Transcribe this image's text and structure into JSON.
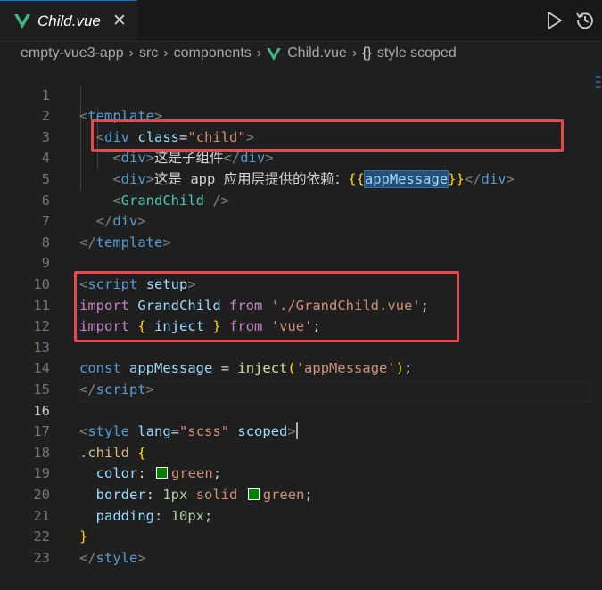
{
  "tab": {
    "label": "Child.vue",
    "close": "✕"
  },
  "breadcrumb": {
    "items": [
      "empty-vue3-app",
      "src",
      "components"
    ],
    "file": "Child.vue",
    "symbol": "style scoped",
    "braces": "{}"
  },
  "colors": {
    "highlight": "#e5484d",
    "accent": "#0078d4",
    "swatch": "#008000"
  },
  "lines": {
    "n1": "1",
    "n2": "2",
    "n3": "3",
    "n4": "4",
    "n5": "5",
    "n6": "6",
    "n7": "7",
    "n8": "8",
    "n9": "9",
    "n10": "10",
    "n11": "11",
    "n12": "12",
    "n13": "13",
    "n14": "14",
    "n15": "15",
    "n16": "16",
    "n17": "17",
    "n18": "18",
    "n19": "19",
    "n20": "20",
    "n21": "21",
    "n22": "22",
    "n23": "23"
  },
  "code": {
    "template": "template",
    "div": "div",
    "class_attr": "class",
    "class_val": "\"child\"",
    "child_text": "这是子组件",
    "app_text": "这是 app 应用层提供的依赖：",
    "app_message": "appMessage",
    "grandchild": "GrandChild",
    "script": "script",
    "setup": "setup",
    "import_kw": "import",
    "from_kw": "from",
    "grandchild_path": "'./GrandChild.vue'",
    "inject": "inject",
    "vue_str": "'vue'",
    "const_kw": "const",
    "app_message_str": "'appMessage'",
    "style": "style",
    "lang_attr": "lang",
    "lang_val": "\"scss\"",
    "scoped": "scoped",
    "child_sel": ".child",
    "color_prop": "color",
    "border_prop": "border",
    "padding_prop": "padding",
    "green": "green",
    "px1": "1px",
    "solid": "solid",
    "px10": "10px"
  }
}
